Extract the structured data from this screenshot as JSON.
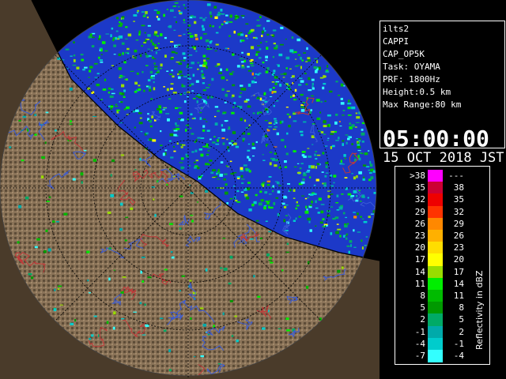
{
  "info": {
    "site": "ilts2",
    "product": "CAPPI",
    "product_code": "CAP_OP5K",
    "task": "Task: OYAMA",
    "prf": "PRF: 1800Hz",
    "height": "Height:0.5 km",
    "max_range": "Max Range:80 km",
    "time": "05:00:00",
    "date": "15 OCT 2018 JST"
  },
  "legend": {
    "title": "Reflectivity in dBZ",
    "rows": [
      {
        "low": ">38",
        "high": "---",
        "color": "#ff00ff"
      },
      {
        "low": "35",
        "high": "38",
        "color": "#cc0033"
      },
      {
        "low": "32",
        "high": "35",
        "color": "#ee0000"
      },
      {
        "low": "29",
        "high": "32",
        "color": "#ff3300"
      },
      {
        "low": "26",
        "high": "29",
        "color": "#ff8800"
      },
      {
        "low": "23",
        "high": "26",
        "color": "#ffb000"
      },
      {
        "low": "20",
        "high": "23",
        "color": "#ffdd00"
      },
      {
        "low": "17",
        "high": "20",
        "color": "#ffff00"
      },
      {
        "low": "14",
        "high": "17",
        "color": "#99dd00"
      },
      {
        "low": "11",
        "high": "14",
        "color": "#00ee00"
      },
      {
        "low": "8",
        "high": "11",
        "color": "#00bb00"
      },
      {
        "low": "5",
        "high": "8",
        "color": "#009900"
      },
      {
        "low": "2",
        "high": "5",
        "color": "#00aa66"
      },
      {
        "low": "-1",
        "high": "2",
        "color": "#00aaaa"
      },
      {
        "low": "-4",
        "high": "-1",
        "color": "#00cccc"
      },
      {
        "low": "-7",
        "high": "-4",
        "color": "#33ffff"
      }
    ]
  },
  "colors": {
    "sea": "#1c39c8",
    "land": "#8a7358",
    "land_dark": "#4f4130",
    "river": "#3a5bd6",
    "border": "#c03838",
    "range_ring": "#000000"
  }
}
